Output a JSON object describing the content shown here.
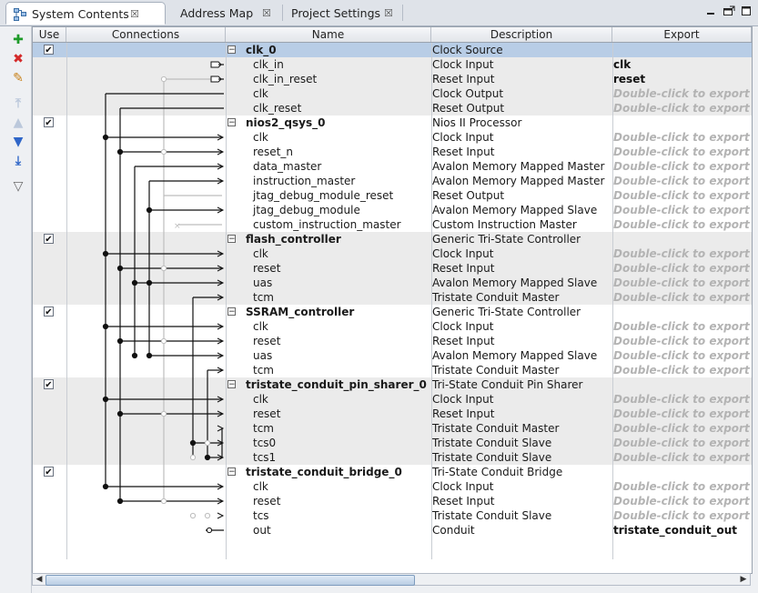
{
  "tabs": [
    {
      "label": "System Contents",
      "close": "☒",
      "active": true
    },
    {
      "label": "Address Map",
      "close": "☒",
      "active": false
    },
    {
      "label": "Project Settings",
      "close": "☒",
      "active": false
    }
  ],
  "window_controls": {
    "minimize_icon": "minimize-icon",
    "restore_icon": "restore-icon",
    "maximize_icon": "maximize-icon"
  },
  "toolbar": [
    {
      "name": "add-button",
      "glyph": "✚",
      "color": "#1f9b2a",
      "enabled": true
    },
    {
      "name": "remove-button",
      "glyph": "✖",
      "color": "#d42a2a",
      "enabled": true
    },
    {
      "name": "edit-button",
      "glyph": "✎",
      "color": "#c77f16",
      "enabled": true
    },
    {
      "name": "move-top-button",
      "glyph": "⤒",
      "color": "#5f7fb0",
      "enabled": false
    },
    {
      "name": "move-up-button",
      "glyph": "▲",
      "color": "#5f7fb0",
      "enabled": false
    },
    {
      "name": "move-down-button",
      "glyph": "▼",
      "color": "#2f66c8",
      "enabled": true
    },
    {
      "name": "move-bottom-button",
      "glyph": "⤓",
      "color": "#2f66c8",
      "enabled": true
    },
    {
      "name": "filter-button",
      "glyph": "▽",
      "color": "#6a6a6a",
      "enabled": true
    }
  ],
  "columns": {
    "use": "Use",
    "connections": "Connections",
    "name": "Name",
    "description": "Description",
    "export": "Export"
  },
  "export_hint": "Double-click to export",
  "rows": [
    {
      "type": "comp",
      "name": "clk_0",
      "desc": "Clock Source",
      "export": "",
      "checked": true
    },
    {
      "type": "iface",
      "name": "clk_in",
      "desc": "Clock Input",
      "export": "clk"
    },
    {
      "type": "iface",
      "name": "clk_in_reset",
      "desc": "Reset Input",
      "export": "reset"
    },
    {
      "type": "iface",
      "name": "clk",
      "desc": "Clock Output",
      "export": "hint"
    },
    {
      "type": "iface",
      "name": "clk_reset",
      "desc": "Reset Output",
      "export": "hint"
    },
    {
      "type": "comp",
      "name": "nios2_qsys_0",
      "desc": "Nios II Processor",
      "export": "",
      "checked": true
    },
    {
      "type": "iface",
      "name": "clk",
      "desc": "Clock Input",
      "export": "hint"
    },
    {
      "type": "iface",
      "name": "reset_n",
      "desc": "Reset Input",
      "export": "hint"
    },
    {
      "type": "iface",
      "name": "data_master",
      "desc": "Avalon Memory Mapped Master",
      "export": "hint"
    },
    {
      "type": "iface",
      "name": "instruction_master",
      "desc": "Avalon Memory Mapped Master",
      "export": "hint"
    },
    {
      "type": "iface",
      "name": "jtag_debug_module_reset",
      "desc": "Reset Output",
      "export": "hint"
    },
    {
      "type": "iface",
      "name": "jtag_debug_module",
      "desc": "Avalon Memory Mapped Slave",
      "export": "hint"
    },
    {
      "type": "iface",
      "name": "custom_instruction_master",
      "desc": "Custom Instruction Master",
      "export": "hint"
    },
    {
      "type": "comp",
      "name": "flash_controller",
      "desc": "Generic Tri-State Controller",
      "export": "",
      "checked": true
    },
    {
      "type": "iface",
      "name": "clk",
      "desc": "Clock Input",
      "export": "hint"
    },
    {
      "type": "iface",
      "name": "reset",
      "desc": "Reset Input",
      "export": "hint"
    },
    {
      "type": "iface",
      "name": "uas",
      "desc": "Avalon Memory Mapped Slave",
      "export": "hint"
    },
    {
      "type": "iface",
      "name": "tcm",
      "desc": "Tristate Conduit Master",
      "export": "hint"
    },
    {
      "type": "comp",
      "name": "SSRAM_controller",
      "desc": "Generic Tri-State Controller",
      "export": "",
      "checked": true
    },
    {
      "type": "iface",
      "name": "clk",
      "desc": "Clock Input",
      "export": "hint"
    },
    {
      "type": "iface",
      "name": "reset",
      "desc": "Reset Input",
      "export": "hint"
    },
    {
      "type": "iface",
      "name": "uas",
      "desc": "Avalon Memory Mapped Slave",
      "export": "hint"
    },
    {
      "type": "iface",
      "name": "tcm",
      "desc": "Tristate Conduit Master",
      "export": "hint"
    },
    {
      "type": "comp",
      "name": "tristate_conduit_pin_sharer_0",
      "desc": "Tri-State Conduit Pin Sharer",
      "export": "",
      "checked": true
    },
    {
      "type": "iface",
      "name": "clk",
      "desc": "Clock Input",
      "export": "hint"
    },
    {
      "type": "iface",
      "name": "reset",
      "desc": "Reset Input",
      "export": "hint"
    },
    {
      "type": "iface",
      "name": "tcm",
      "desc": "Tristate Conduit Master",
      "export": "hint"
    },
    {
      "type": "iface",
      "name": "tcs0",
      "desc": "Tristate Conduit Slave",
      "export": "hint"
    },
    {
      "type": "iface",
      "name": "tcs1",
      "desc": "Tristate Conduit Slave",
      "export": "hint"
    },
    {
      "type": "comp",
      "name": "tristate_conduit_bridge_0",
      "desc": "Tri-State Conduit Bridge",
      "export": "",
      "checked": true
    },
    {
      "type": "iface",
      "name": "clk",
      "desc": "Clock Input",
      "export": "hint"
    },
    {
      "type": "iface",
      "name": "reset",
      "desc": "Reset Input",
      "export": "hint"
    },
    {
      "type": "iface",
      "name": "tcs",
      "desc": "Tristate Conduit Slave",
      "export": "hint"
    },
    {
      "type": "iface",
      "name": "out",
      "desc": "Conduit",
      "export": "tristate_conduit_out"
    }
  ],
  "colors": {
    "selected_row": "#b8cde6",
    "band_row": "#ebebeb",
    "line_active": "#111111",
    "line_inactive": "#bdbdbd"
  }
}
